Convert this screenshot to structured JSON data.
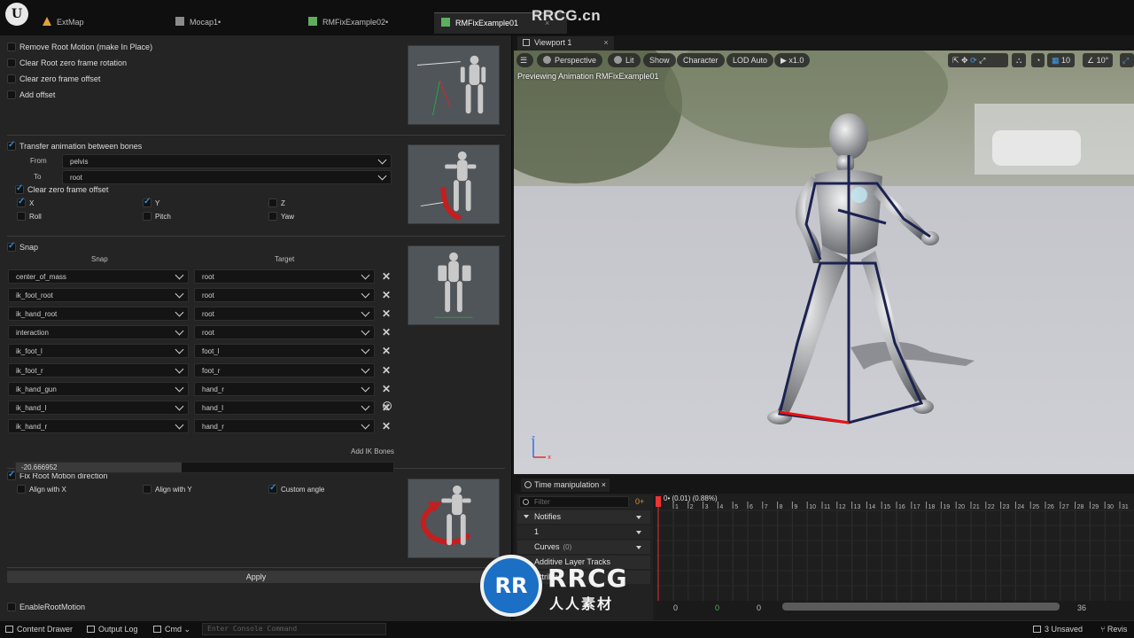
{
  "tabs": [
    {
      "label": "ExtMap",
      "color": "#e0a23a"
    },
    {
      "label": "Mocap1•",
      "color": "#8a8a8a"
    },
    {
      "label": "RMFixExample02•",
      "color": "#5fae5f"
    },
    {
      "label": "RMFixExample01",
      "color": "#5fae5f",
      "close": "×"
    }
  ],
  "watermark_top": "RRCG.cn",
  "left": {
    "section1": [
      {
        "label": "Remove Root Motion (make In Place)",
        "checked": false
      },
      {
        "label": "Clear Root zero frame rotation",
        "checked": false
      },
      {
        "label": "Clear zero frame offset",
        "checked": false
      },
      {
        "label": "Add offset",
        "checked": false
      }
    ],
    "transfer": {
      "label": "Transfer animation between bones",
      "checked": true,
      "from_label": "From",
      "from_value": "pelvis",
      "to_label": "To",
      "to_value": "root",
      "clear_offset": "Clear zero frame offset",
      "axes": [
        {
          "label": "X",
          "checked": true
        },
        {
          "label": "Y",
          "checked": true
        },
        {
          "label": "Z",
          "checked": false
        },
        {
          "label": "Roll",
          "checked": false
        },
        {
          "label": "Pitch",
          "checked": false
        },
        {
          "label": "Yaw",
          "checked": false
        }
      ]
    },
    "snap": {
      "label": "Snap",
      "checked": true,
      "col_snap": "Snap",
      "col_target": "Target",
      "rows": [
        {
          "snap": "center_of_mass",
          "target": "root"
        },
        {
          "snap": "ik_foot_root",
          "target": "root"
        },
        {
          "snap": "ik_hand_root",
          "target": "root"
        },
        {
          "snap": "interaction",
          "target": "root"
        },
        {
          "snap": "ik_foot_l",
          "target": "foot_l"
        },
        {
          "snap": "ik_foot_r",
          "target": "foot_r"
        },
        {
          "snap": "ik_hand_gun",
          "target": "hand_r"
        },
        {
          "snap": "ik_hand_l",
          "target": "hand_l"
        },
        {
          "snap": "ik_hand_r",
          "target": "hand_r"
        }
      ],
      "add_label": "Add IK Bones",
      "remove_glyph": "✕",
      "add_glyph": "+"
    },
    "fix": {
      "label": "Fix Root Motion direction",
      "checked": true,
      "align_x": "Align with X",
      "align_y": "Align with Y",
      "custom": "Custom angle",
      "angle": "-20.666952",
      "angle_fill": 0.44
    },
    "apply": "Apply",
    "enable_root": "EnableRootMotion"
  },
  "viewport": {
    "tab": "Viewport 1",
    "tab_close": "×",
    "perspective": "Perspective",
    "lit": "Lit",
    "show": "Show",
    "character": "Character",
    "lod": "LOD Auto",
    "speed": "x1.0",
    "grid": "10",
    "angle": "10°",
    "preview": "Previewing Animation RMFixExample01"
  },
  "timeline": {
    "tab": "Time manipulation",
    "tab_close": "×",
    "filter_placeholder": "Filter",
    "add": "0+",
    "notifies": "Notifies",
    "track1": "1",
    "curves": "Curves",
    "curves_count": "(0)",
    "additive": "Additive Layer Tracks",
    "attributes": "Attribu",
    "frame_label": "0• (0.01) (0.88%)",
    "ticks": [
      "1",
      "2",
      "3",
      "4",
      "5",
      "6",
      "7",
      "8",
      "9",
      "10",
      "11",
      "12",
      "13",
      "14",
      "15",
      "16",
      "17",
      "18",
      "19",
      "20",
      "21",
      "22",
      "23",
      "24",
      "25",
      "26",
      "27",
      "28",
      "29",
      "30",
      "31"
    ],
    "bottom_values": [
      "0",
      "0",
      "0",
      "36"
    ]
  },
  "statusbar": {
    "content_drawer": "Content Drawer",
    "output_log": "Output Log",
    "cmd": "Cmd",
    "console_placeholder": "Enter Console Command",
    "unsaved": "3 Unsaved",
    "revision": "Revis"
  },
  "watermark": {
    "badge": "RR",
    "text": "RRCG",
    "sub": "人人素材"
  },
  "colors": {
    "accent": "#2f8bd8",
    "panel": "#242424",
    "red_arrow": "#d42020"
  }
}
